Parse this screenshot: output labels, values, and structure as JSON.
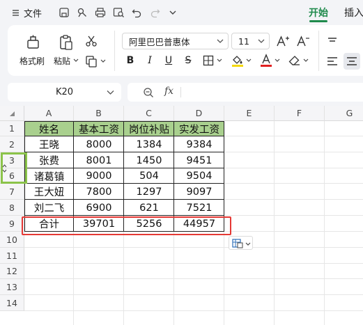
{
  "titlebar": {
    "menu_label": "文件",
    "tab_start": "开始",
    "tab_insert": "插入"
  },
  "ribbon": {
    "format_painter": "格式刷",
    "paste": "粘贴",
    "font_name": "阿里巴巴普惠体",
    "font_size": "11"
  },
  "formula_bar": {
    "name_box": "K20",
    "fx": "fx",
    "value": ""
  },
  "sheet": {
    "columns": [
      "A",
      "B",
      "C",
      "D",
      "E",
      "F",
      "G"
    ],
    "rows": [
      "1",
      "2",
      "3",
      "6",
      "7",
      "8",
      "9",
      "10",
      "11",
      "12",
      "13",
      "14"
    ],
    "table": [
      [
        "姓名",
        "基本工资",
        "岗位补贴",
        "实发工资"
      ],
      [
        "王晓",
        "8000",
        "1384",
        "9384"
      ],
      [
        "张费",
        "8001",
        "1450",
        "9451"
      ],
      [
        "诸葛镇",
        "9000",
        "504",
        "9504"
      ],
      [
        "王大妞",
        "7800",
        "1297",
        "9097"
      ],
      [
        "刘二飞",
        "6900",
        "621",
        "7521"
      ],
      [
        "合计",
        "39701",
        "5256",
        "44957"
      ]
    ]
  },
  "colors": {
    "accent": "#1f8a4c",
    "header_fill": "#a9d08e",
    "highlight_red": "#e53935",
    "hidden_rows_marker": "#8bc34a",
    "font_highlight_yellow": "#f5d90a",
    "font_color_red": "#e02020"
  }
}
